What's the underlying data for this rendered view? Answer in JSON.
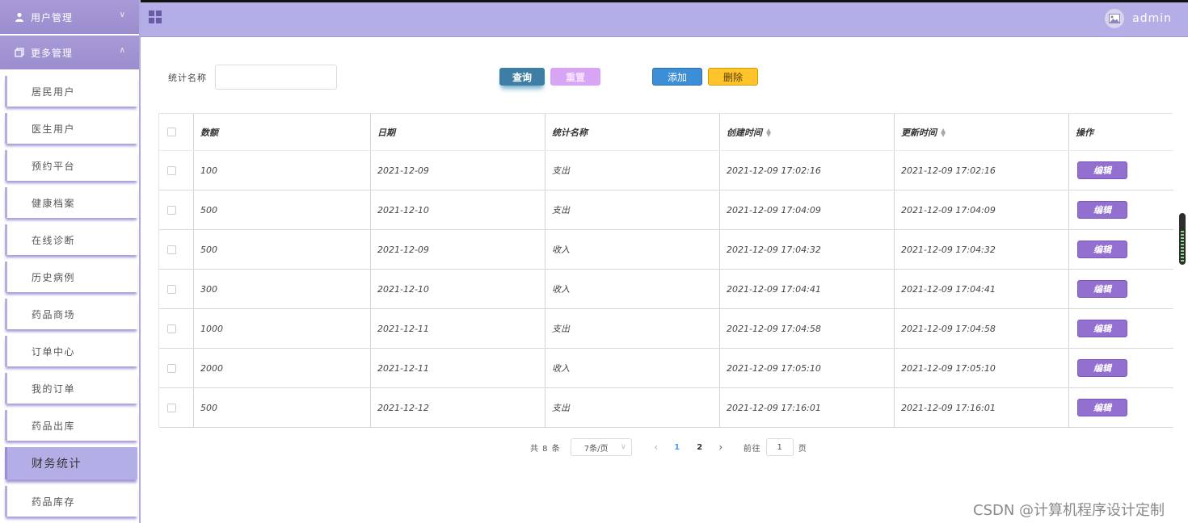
{
  "sidebar": {
    "groups": [
      {
        "label": "用户管理",
        "icon": "user-icon"
      },
      {
        "label": "更多管理",
        "icon": "copy-icon"
      }
    ],
    "items": [
      {
        "label": "居民用户"
      },
      {
        "label": "医生用户"
      },
      {
        "label": "预约平台"
      },
      {
        "label": "健康档案"
      },
      {
        "label": "在线诊断"
      },
      {
        "label": "历史病例"
      },
      {
        "label": "药品商场"
      },
      {
        "label": "订单中心"
      },
      {
        "label": "我的订单"
      },
      {
        "label": "药品出库"
      },
      {
        "label": "财务统计"
      },
      {
        "label": "药品库存"
      }
    ],
    "active_item": "财务统计"
  },
  "header": {
    "menu_icon": "grid-icon",
    "avatar_icon": "image-icon",
    "username": "admin"
  },
  "search": {
    "label": "统计名称",
    "value": "",
    "placeholder": "",
    "query_label": "查询",
    "reset_label": "重置",
    "add_label": "添加",
    "delete_label": "删除"
  },
  "table": {
    "columns": [
      "数额",
      "日期",
      "统计名称",
      "创建时间",
      "更新时间",
      "操作"
    ],
    "sortable_columns": [
      "创建时间",
      "更新时间"
    ],
    "edit_label": "编辑",
    "rows": [
      {
        "amount": "100",
        "date": "2021-12-09",
        "name": "支出",
        "created": "2021-12-09 17:02:16",
        "updated": "2021-12-09 17:02:16"
      },
      {
        "amount": "500",
        "date": "2021-12-10",
        "name": "支出",
        "created": "2021-12-09 17:04:09",
        "updated": "2021-12-09 17:04:09"
      },
      {
        "amount": "500",
        "date": "2021-12-09",
        "name": "收入",
        "created": "2021-12-09 17:04:32",
        "updated": "2021-12-09 17:04:32"
      },
      {
        "amount": "300",
        "date": "2021-12-10",
        "name": "收入",
        "created": "2021-12-09 17:04:41",
        "updated": "2021-12-09 17:04:41"
      },
      {
        "amount": "1000",
        "date": "2021-12-11",
        "name": "支出",
        "created": "2021-12-09 17:04:58",
        "updated": "2021-12-09 17:04:58"
      },
      {
        "amount": "2000",
        "date": "2021-12-11",
        "name": "收入",
        "created": "2021-12-09 17:05:10",
        "updated": "2021-12-09 17:05:10"
      },
      {
        "amount": "500",
        "date": "2021-12-12",
        "name": "支出",
        "created": "2021-12-09 17:16:01",
        "updated": "2021-12-09 17:16:01"
      }
    ]
  },
  "pagination": {
    "total_text": "共 8 条",
    "page_size": "7条/页",
    "pages": [
      "1",
      "2"
    ],
    "current_page": "1",
    "goto_label": "前往",
    "goto_value": "1",
    "page_unit": "页"
  },
  "watermark": "CSDN @计算机程序设计定制",
  "colors": {
    "accent": "#b4aee6",
    "sidebar_header": "#a89ad6",
    "query_button": "#3e7ea4",
    "reset_button": "#d8a4f4",
    "add_button": "#3c8ed6",
    "delete_button": "#ffc42b",
    "edit_button": "#9370d0"
  }
}
